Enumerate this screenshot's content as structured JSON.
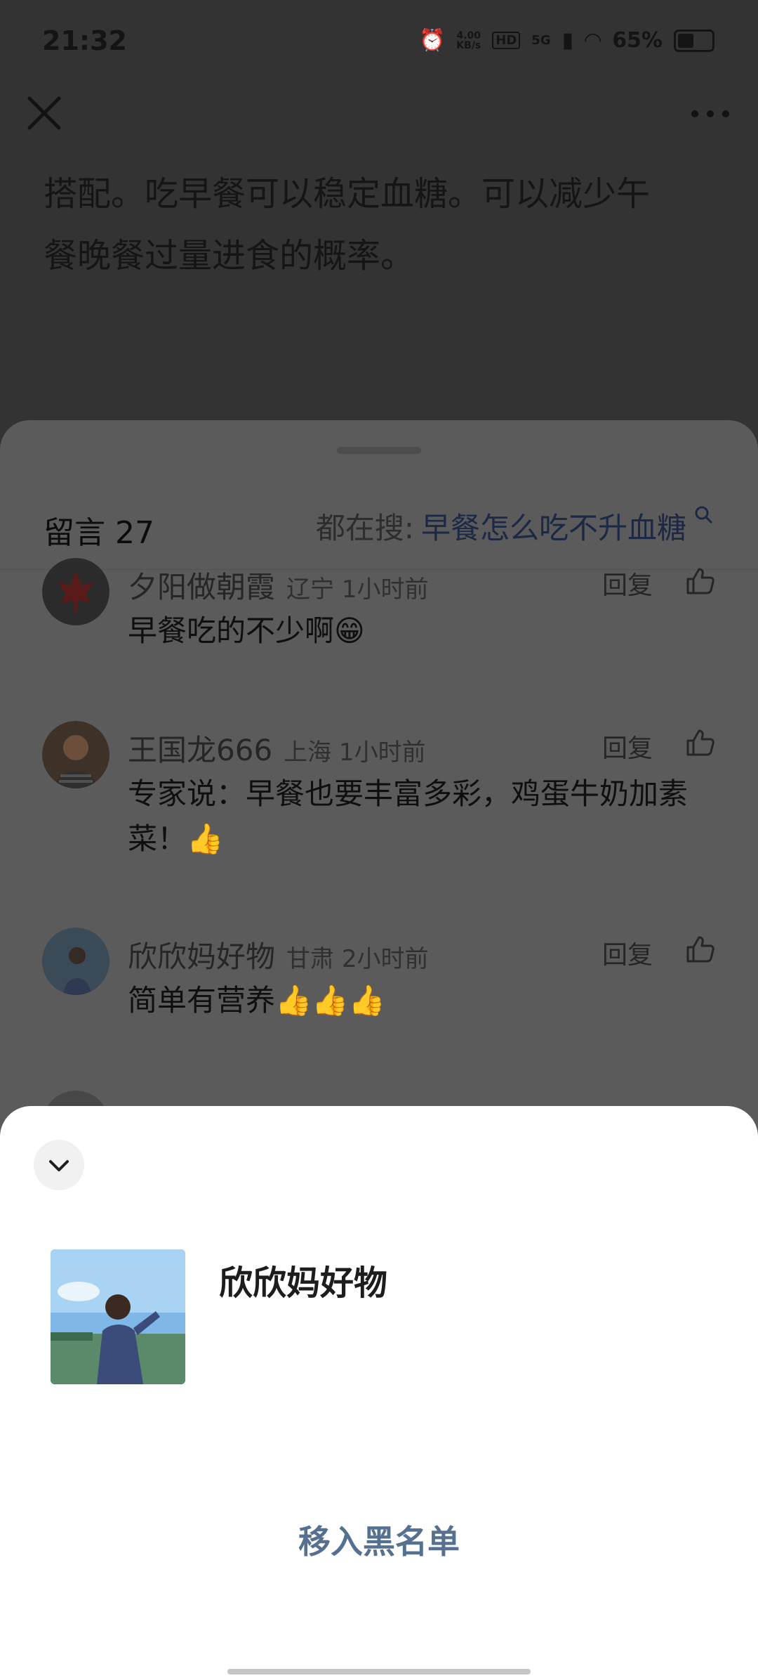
{
  "status_bar": {
    "time": "21:32",
    "net_speed": "4.00\nKB/s",
    "hd": "HD",
    "network": "5G",
    "battery": "65%"
  },
  "top_bar": {
    "close_icon": "close-icon",
    "more_icon": "more-icon"
  },
  "article": {
    "line1": "搭配。吃早餐可以稳定血糖。可以减少午",
    "line2": "餐晚餐过量进食的概率。"
  },
  "comments_sheet": {
    "count_label": "留言 27",
    "search_prefix": "都在搜:",
    "search_keyword": "早餐怎么吃不升血糖",
    "comments": [
      {
        "name": "夕阳做朝霞",
        "meta": "辽宁 1小时前",
        "reply": "回复",
        "text": "早餐吃的不少啊😁"
      },
      {
        "name": "王国龙666",
        "meta": "上海 1小时前",
        "reply": "回复",
        "text": "专家说：早餐也要丰富多彩，鸡蛋牛奶加素菜！👍"
      },
      {
        "name": "欣欣妈好物",
        "meta": "甘肃 2小时前",
        "reply": "回复",
        "text": "简单有营养👍👍👍"
      }
    ]
  },
  "action_panel": {
    "user_name": "欣欣妈好物",
    "blacklist_label": "移入黑名单"
  },
  "colors": {
    "accent": "#56708f",
    "overlay_bg": "#333333",
    "panel_bg": "#ffffff"
  }
}
